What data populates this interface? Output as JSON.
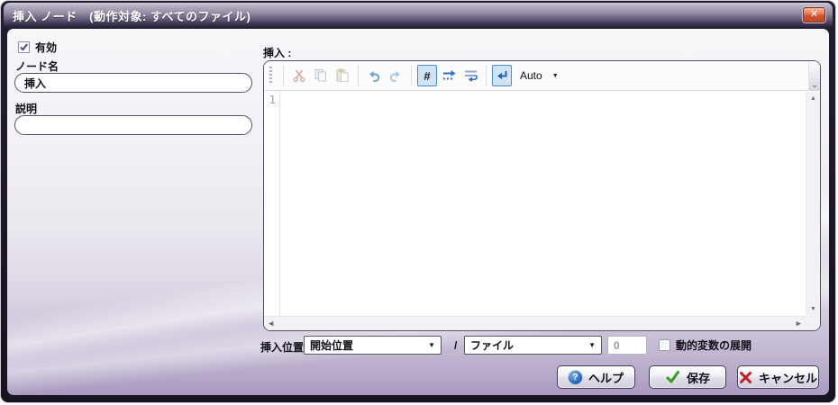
{
  "window": {
    "title": "挿入 ノード　(動作対象: すべてのファイル)",
    "close_glyph": "✕"
  },
  "form": {
    "enabled_label": "有効",
    "enabled_checked": true,
    "node_name_label": "ノード名",
    "node_name_value": "挿入",
    "description_label": "説明",
    "description_value": ""
  },
  "editor": {
    "label": "挿入 :",
    "line_number": "1",
    "toolbar": {
      "hash_button_label": "#",
      "auto_dropdown_label": "Auto"
    }
  },
  "position_row": {
    "insert_position_label": "挿入位置",
    "position_select_value": "開始位置",
    "separator": "/",
    "unit_select_value": "ファイル",
    "offset_value": "0",
    "dynamic_variable_label": "動的変数の展開",
    "dynamic_variable_checked": false
  },
  "actions": {
    "help_label": "ヘルプ",
    "help_icon_glyph": "?",
    "save_label": "保存",
    "cancel_label": "キャンセル"
  },
  "glyphs": {
    "dropdown_caret": "▼",
    "scroll_up": "▲",
    "scroll_down": "▼",
    "scroll_left": "◀",
    "scroll_right": "▶",
    "overflow_chevron": "⌄"
  },
  "colors": {
    "titlebar_dark": "#272138",
    "close_button_red": "#d05531",
    "toggle_active_bg": "#cfe4f7",
    "toggle_active_border": "#4d8bc9",
    "help_icon_blue": "#2a6cc0",
    "save_check_green": "#2fa01f",
    "cancel_x_red": "#c41a1a",
    "content_bottom_purple": "#a99bc0"
  }
}
